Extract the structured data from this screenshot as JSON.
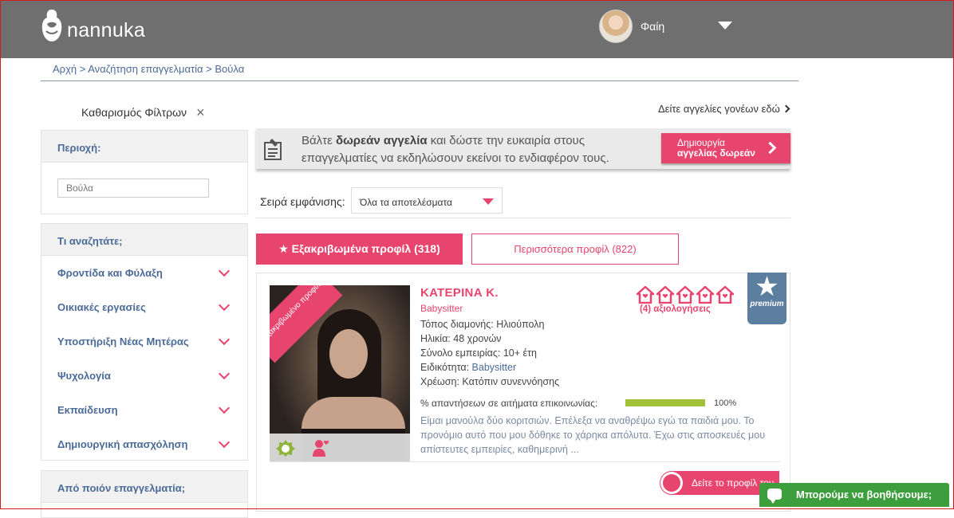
{
  "header": {
    "logo_text": "nannuka",
    "user_name": "Φαίη"
  },
  "breadcrumb": "Αρχή > Αναζήτηση επαγγελματία > Βούλα",
  "filters": {
    "clear_label": "Καθαρισμός Φίλτρων",
    "area_title": "Περιοχή:",
    "area_value": "Βούλα",
    "search_title": "Τι αναζητάτε;",
    "categories": [
      "Φροντίδα και Φύλαξη",
      "Οικιακές εργασίες",
      "Υποστήριξη Νέας Μητέρας",
      "Ψυχολογία",
      "Εκπαίδευση",
      "Δημιουργική απασχόληση"
    ],
    "from_title": "Από ποιόν επαγγελματία;"
  },
  "main": {
    "parent_ads_link": "Δείτε αγγελίες γονέων εδώ",
    "ad": {
      "text_before": "Βάλτε ",
      "text_bold": "δωρεάν αγγελία",
      "text_after": " και δώστε την ευκαιρία στους επαγγελματίες να εκδηλώσουν εκείνοι το ενδιαφέρον τους.",
      "button_line1": "Δημιουργία",
      "button_line2": "αγγελίας δωρεάν"
    },
    "sort_label": "Σειρά εμφάνισης:",
    "sort_value": "Όλα τα αποτελέσματα",
    "tab_verified": "★ Εξακριβωμένα προφίλ (318)",
    "tab_more": "Περισσότερα προφίλ (822)"
  },
  "profile": {
    "ribbon": "Εξακριβωμένο προφίλ",
    "name": "ΚΑΤΕΡΙΝΑ Κ.",
    "role": "Babysitter",
    "location_label": "Τόπος διαμονής: ",
    "location": "Ηλιούπολη",
    "age_label": "Ηλικία: ",
    "age": "48 χρονών",
    "experience_label": "Σύνολο εμπειρίας: ",
    "experience": "10+ έτη",
    "specialty_label": "Ειδικότητα: ",
    "specialty": "Babysitter",
    "charge_label": "Χρέωση: ",
    "charge": "Κατόπιν συνεννόησης",
    "reviews": "(4) αξιολογήσεις",
    "rating": 5,
    "premium_label": "premium",
    "response_label": "% απαντήσεων σε αιτήματα επικοινωνίας:",
    "response_rate": 100,
    "response_pct": "100%",
    "bio": "Είμαι μανούλα δύο κοριτσιών. Επέλεξα να αναθρέψω εγώ τα παιδιά μου. Το προνόμιο αυτό που μου δόθηκε το χάρηκα απόλυτα. Έχω στις αποσκευές μου απίστευτες εμπειρίες, καθημερινή ...",
    "view_button": "Δείτε το προφίλ του"
  },
  "help_chat": "Μπορούμε να βοηθήσουμε;",
  "colors": {
    "accent": "#e8456e",
    "header": "#6f6f6f",
    "link": "#4b6b97",
    "progress": "#a3c23b",
    "premium": "#5c7fa0",
    "help": "#3d9e3d"
  }
}
